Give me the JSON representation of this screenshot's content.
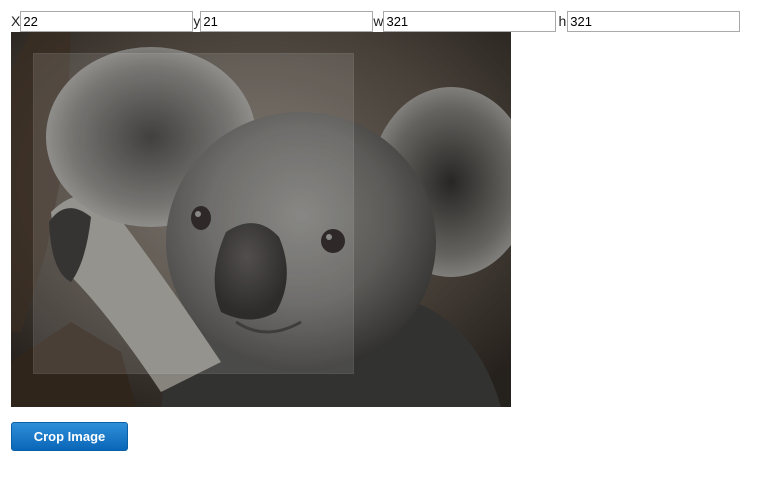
{
  "crop_form": {
    "x_label": "X",
    "x_value": "22",
    "y_label": "y",
    "y_value": "21",
    "w_label": "w",
    "w_value": "321",
    "h_label": "h",
    "h_value": "321"
  },
  "image": {
    "subject": "koala",
    "selection_overlay_color": "#ffffff"
  },
  "actions": {
    "crop_button_label": "Crop Image",
    "crop_button_color": "#0a66b8"
  }
}
